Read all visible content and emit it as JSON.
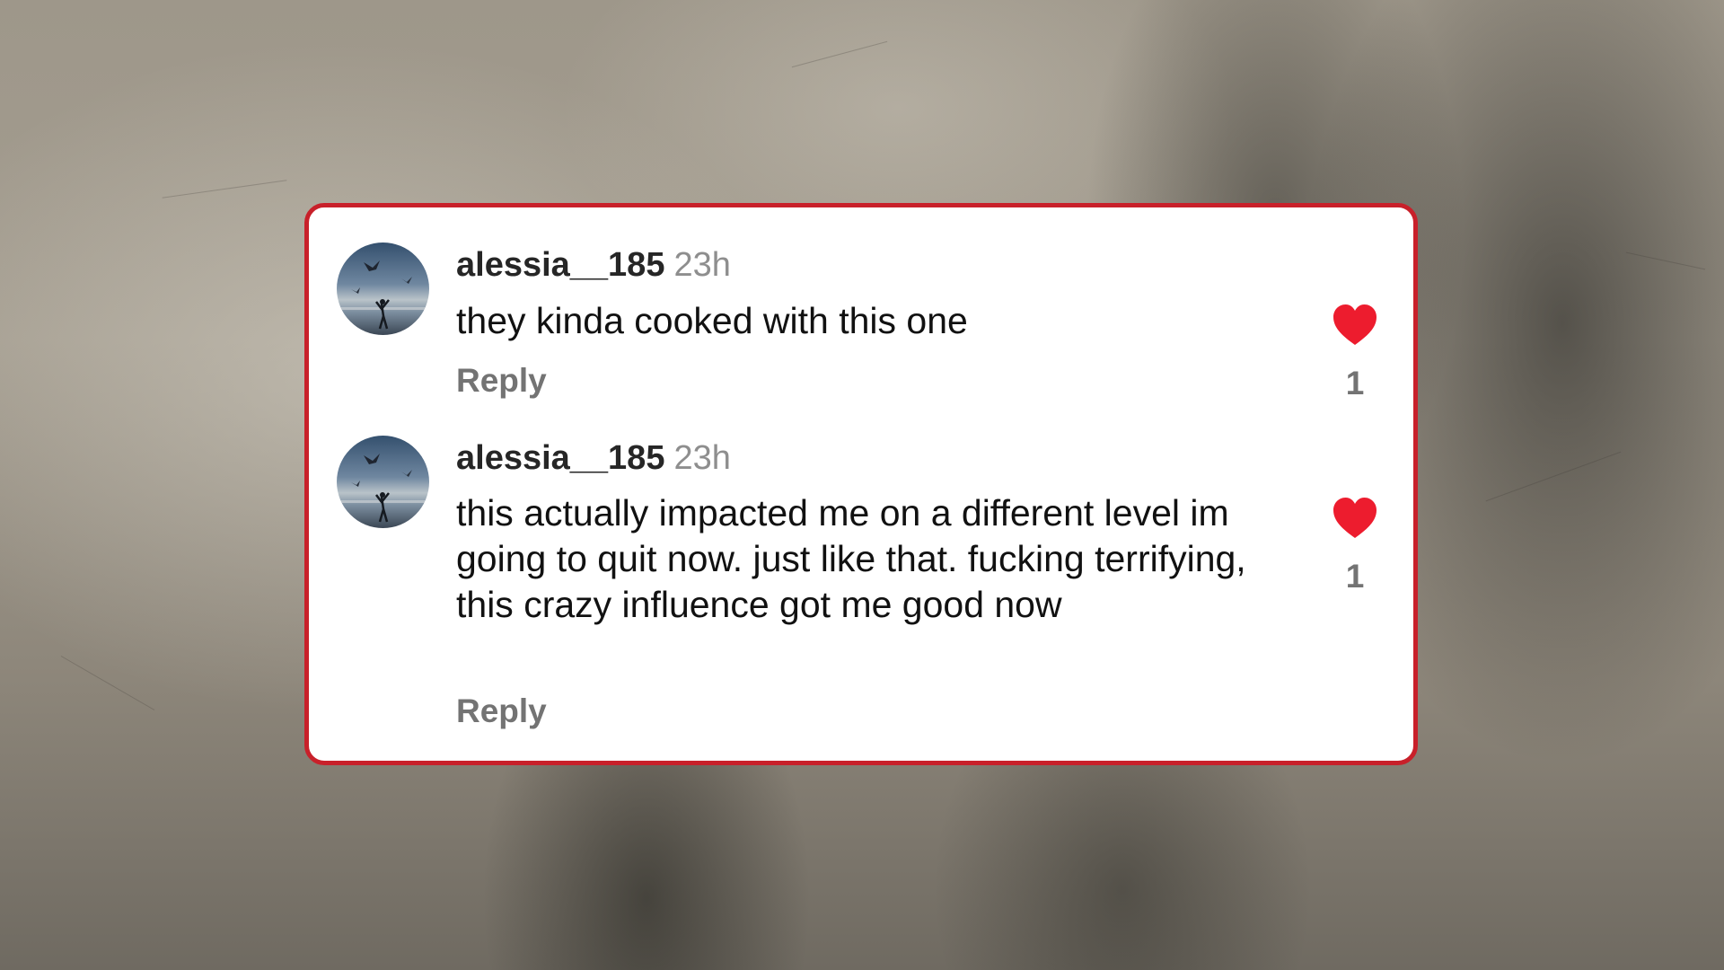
{
  "comments": [
    {
      "username": "alessia__185",
      "time": "23h",
      "text": "they kinda cooked with this one",
      "reply_label": "Reply",
      "like_count": "1",
      "liked": true
    },
    {
      "username": "alessia__185",
      "time": "23h",
      "text": "this actually impacted me on a different level im going to quit now. just like that. fucking terrifying, this crazy influence got me good now",
      "reply_label": "Reply",
      "like_count": "1",
      "liked": true
    }
  ],
  "icons": {
    "like": "heart-icon",
    "avatar": "avatar-image"
  },
  "colors": {
    "card_border": "#c8202a",
    "heart": "#ed1c2e",
    "username": "#262626",
    "secondary_text": "#737373"
  }
}
